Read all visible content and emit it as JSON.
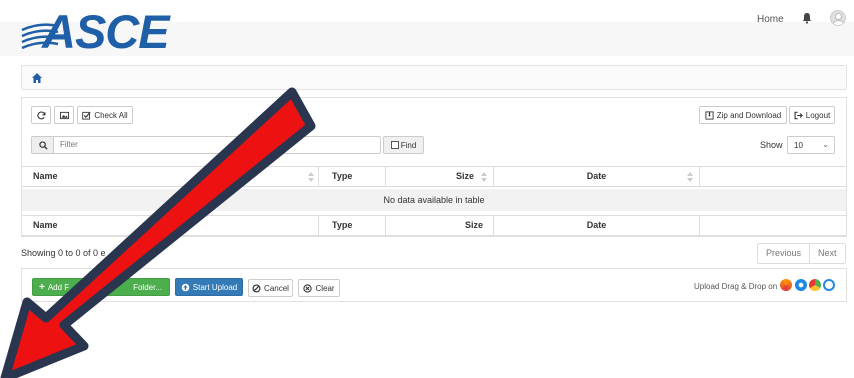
{
  "header": {
    "logo_text": "ASCE",
    "nav_home": "Home",
    "icons": [
      "bell-icon",
      "user-avatar-icon"
    ]
  },
  "breadcrumb": {
    "icon": "home-icon"
  },
  "toolbar": {
    "check_all": "Check All",
    "zip_download": "Zip and Download",
    "logout": "Logout"
  },
  "filter": {
    "placeholder": "Filter",
    "find_label": "Find",
    "show_label": "Show",
    "show_value": "10"
  },
  "table": {
    "columns": [
      "Name",
      "Type",
      "Size",
      "Date"
    ],
    "empty_message": "No data available in table"
  },
  "pagination": {
    "info": "Showing 0 to 0 of 0 e",
    "previous": "Previous",
    "next": "Next"
  },
  "upload": {
    "add_files": "Add F",
    "add_folder": "Folder...",
    "start_upload": "Start Upload",
    "cancel": "Cancel",
    "clear": "Clear",
    "drag_drop": "Upload Drag & Drop on"
  },
  "colors": {
    "brand_blue": "#1f5fa8",
    "success_green": "#4cae4c",
    "primary_blue": "#337ab7",
    "arrow_red": "#ee1111",
    "arrow_outline": "#2a3550"
  }
}
